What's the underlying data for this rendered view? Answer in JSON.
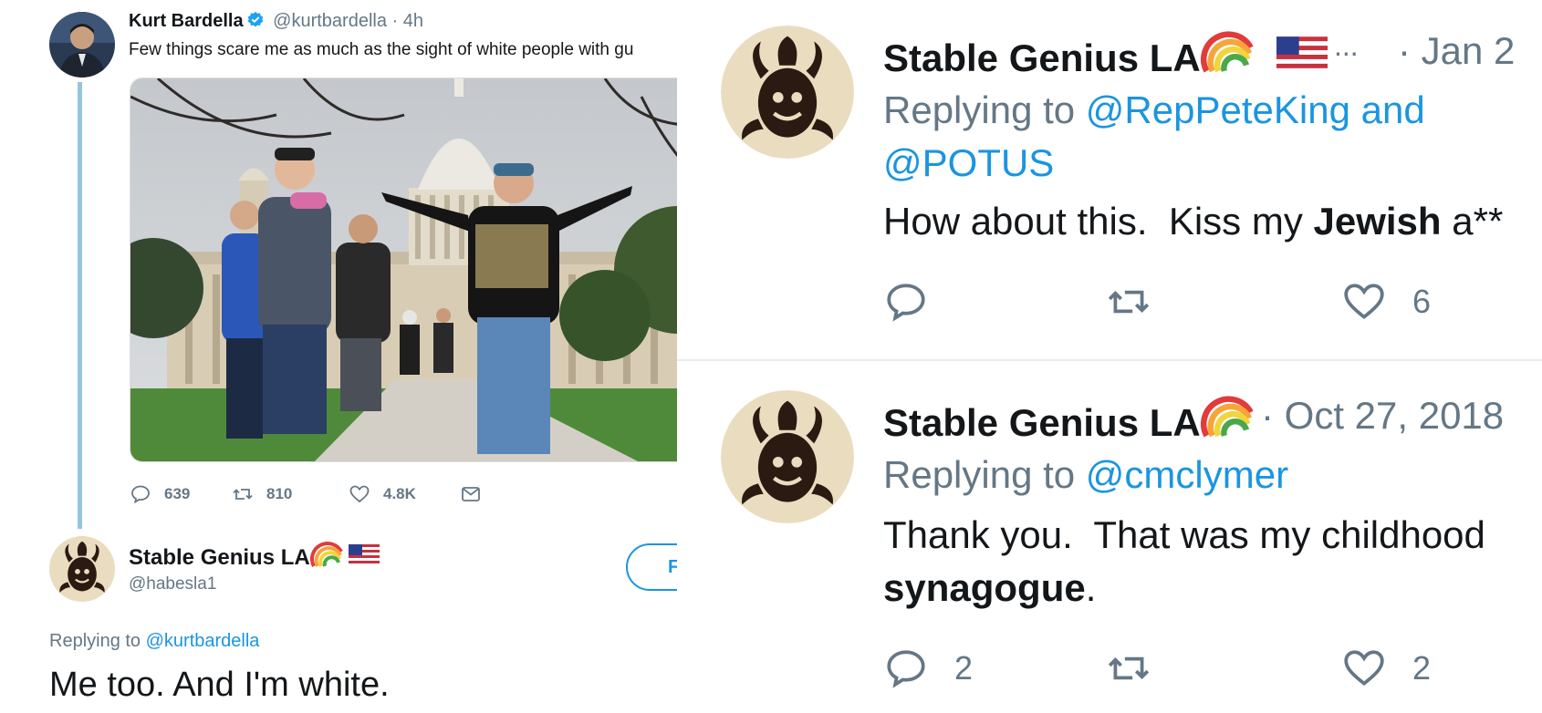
{
  "left_tweet": {
    "author_name": "Kurt Bardella",
    "author_handle": "@kurtbardella",
    "time": "· 4h",
    "text": "Few things scare me as much as the sight of white people with gu",
    "actions": {
      "reply_count": "639",
      "retweet_count": "810",
      "like_count": "4.8K"
    }
  },
  "left_reply": {
    "author_name": "Stable Genius LA",
    "author_handle": "@habesla1",
    "follow_label": "F",
    "replying_prefix": "Replying to",
    "replying_to": "@kurtbardella",
    "text": "Me too.  And I'm white."
  },
  "right_tweets": [
    {
      "author_name": "Stable Genius LA",
      "ellipsis": "...",
      "date": "· Jan 2",
      "replying_prefix": "Replying to",
      "replying_to_1": "@RepPeteKing and",
      "replying_to_2": "@POTUS",
      "text_before": "How about this.  Kiss my ",
      "text_bold": "Jewish",
      "text_after": " a**",
      "reply_count": "",
      "like_count": "6"
    },
    {
      "author_name": "Stable Genius LA",
      "date": "· Oct 27, 2018",
      "replying_prefix": "Replying to",
      "replying_to_1": "@cmclymer",
      "text_line1": "Thank you.  That was my childhood",
      "text_bold": "synagogue",
      "text_after": ".",
      "reply_count": "2",
      "like_count": "2"
    }
  ],
  "icons": [
    "verified-badge-icon",
    "reply-icon",
    "retweet-icon",
    "like-icon",
    "dm-icon",
    "rainbow-emoji",
    "us-flag-emoji"
  ],
  "colors": {
    "link_blue": "#1b95e0",
    "muted_grey": "#657786",
    "text": "#14171a",
    "thread_line": "#94c5e0"
  }
}
